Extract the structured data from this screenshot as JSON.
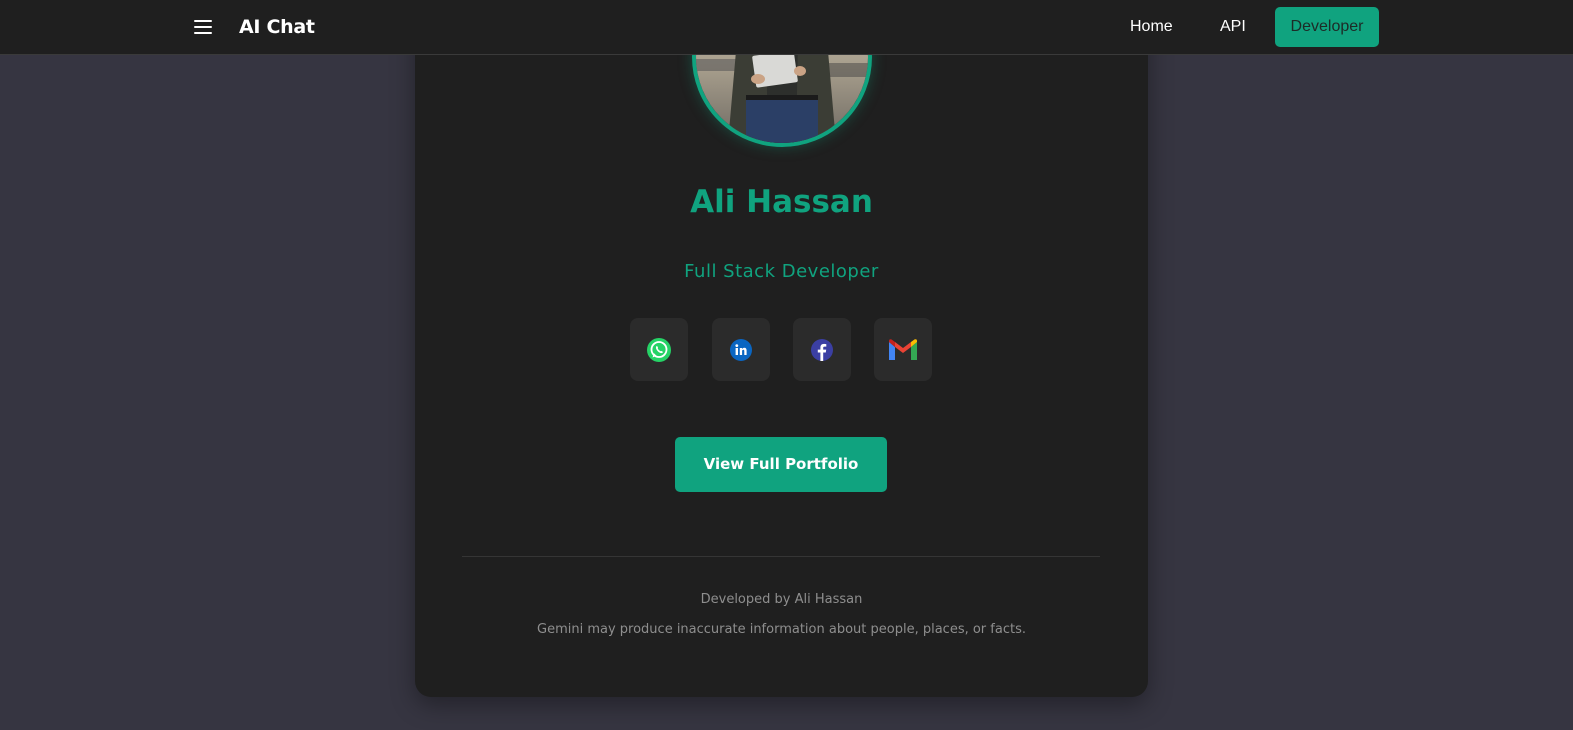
{
  "navbar": {
    "menu_icon": "hamburger-menu-icon",
    "brand": "AI Chat",
    "links": {
      "home": "Home",
      "api": "API",
      "developer": "Developer"
    },
    "active": "Developer"
  },
  "profile": {
    "name": "Ali Hassan",
    "role": "Full Stack Developer",
    "photo_icon": "profile-photo"
  },
  "socials": [
    {
      "icon": "whatsapp-icon"
    },
    {
      "icon": "linkedin-icon"
    },
    {
      "icon": "facebook-icon"
    },
    {
      "icon": "gmail-icon"
    }
  ],
  "portfolio_button": "View Full Portfolio",
  "footer": {
    "credit": "Developed by Ali Hassan",
    "disclaimer": "Gemini may produce inaccurate information about people, places, or facts."
  },
  "colors": {
    "accent": "#10a37f",
    "page_bg": "#363541",
    "card_bg": "#1f1f1f",
    "navbar_bg": "#1f1f1f"
  }
}
